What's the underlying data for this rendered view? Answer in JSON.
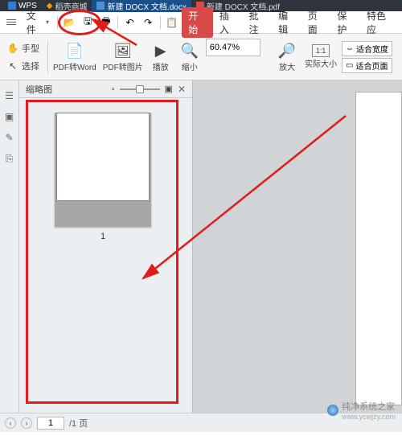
{
  "tabs": {
    "wps": "WPS",
    "t1": "稻壳商城",
    "t2": "新建 DOCX 文档.docx",
    "t3": "新建 DOCX 文档.pdf"
  },
  "menu": {
    "file": "文件",
    "start": "开始",
    "insert": "插入",
    "annotate": "批注",
    "edit": "编辑",
    "page": "页面",
    "protect": "保护",
    "feature": "特色应"
  },
  "toolbar": {
    "hand": "手型",
    "select": "选择",
    "pdf2word": "PDF转Word",
    "pdf2img": "PDF转图片",
    "play": "播放",
    "zoomout": "缩小",
    "zoom_value": "60.47%",
    "zoomin": "放大",
    "actual": "实际大小",
    "fitwidth": "适合宽度",
    "fitpage": "适合页面"
  },
  "panel": {
    "title": "缩略图",
    "page_num": "1"
  },
  "status": {
    "page_input": "1",
    "page_total": "/1 页"
  },
  "watermark": {
    "brand": "纯净系统之家",
    "url": "www.ycwjzy.com"
  },
  "colors": {
    "accent": "#e21b1b",
    "start": "#d84a4a"
  }
}
